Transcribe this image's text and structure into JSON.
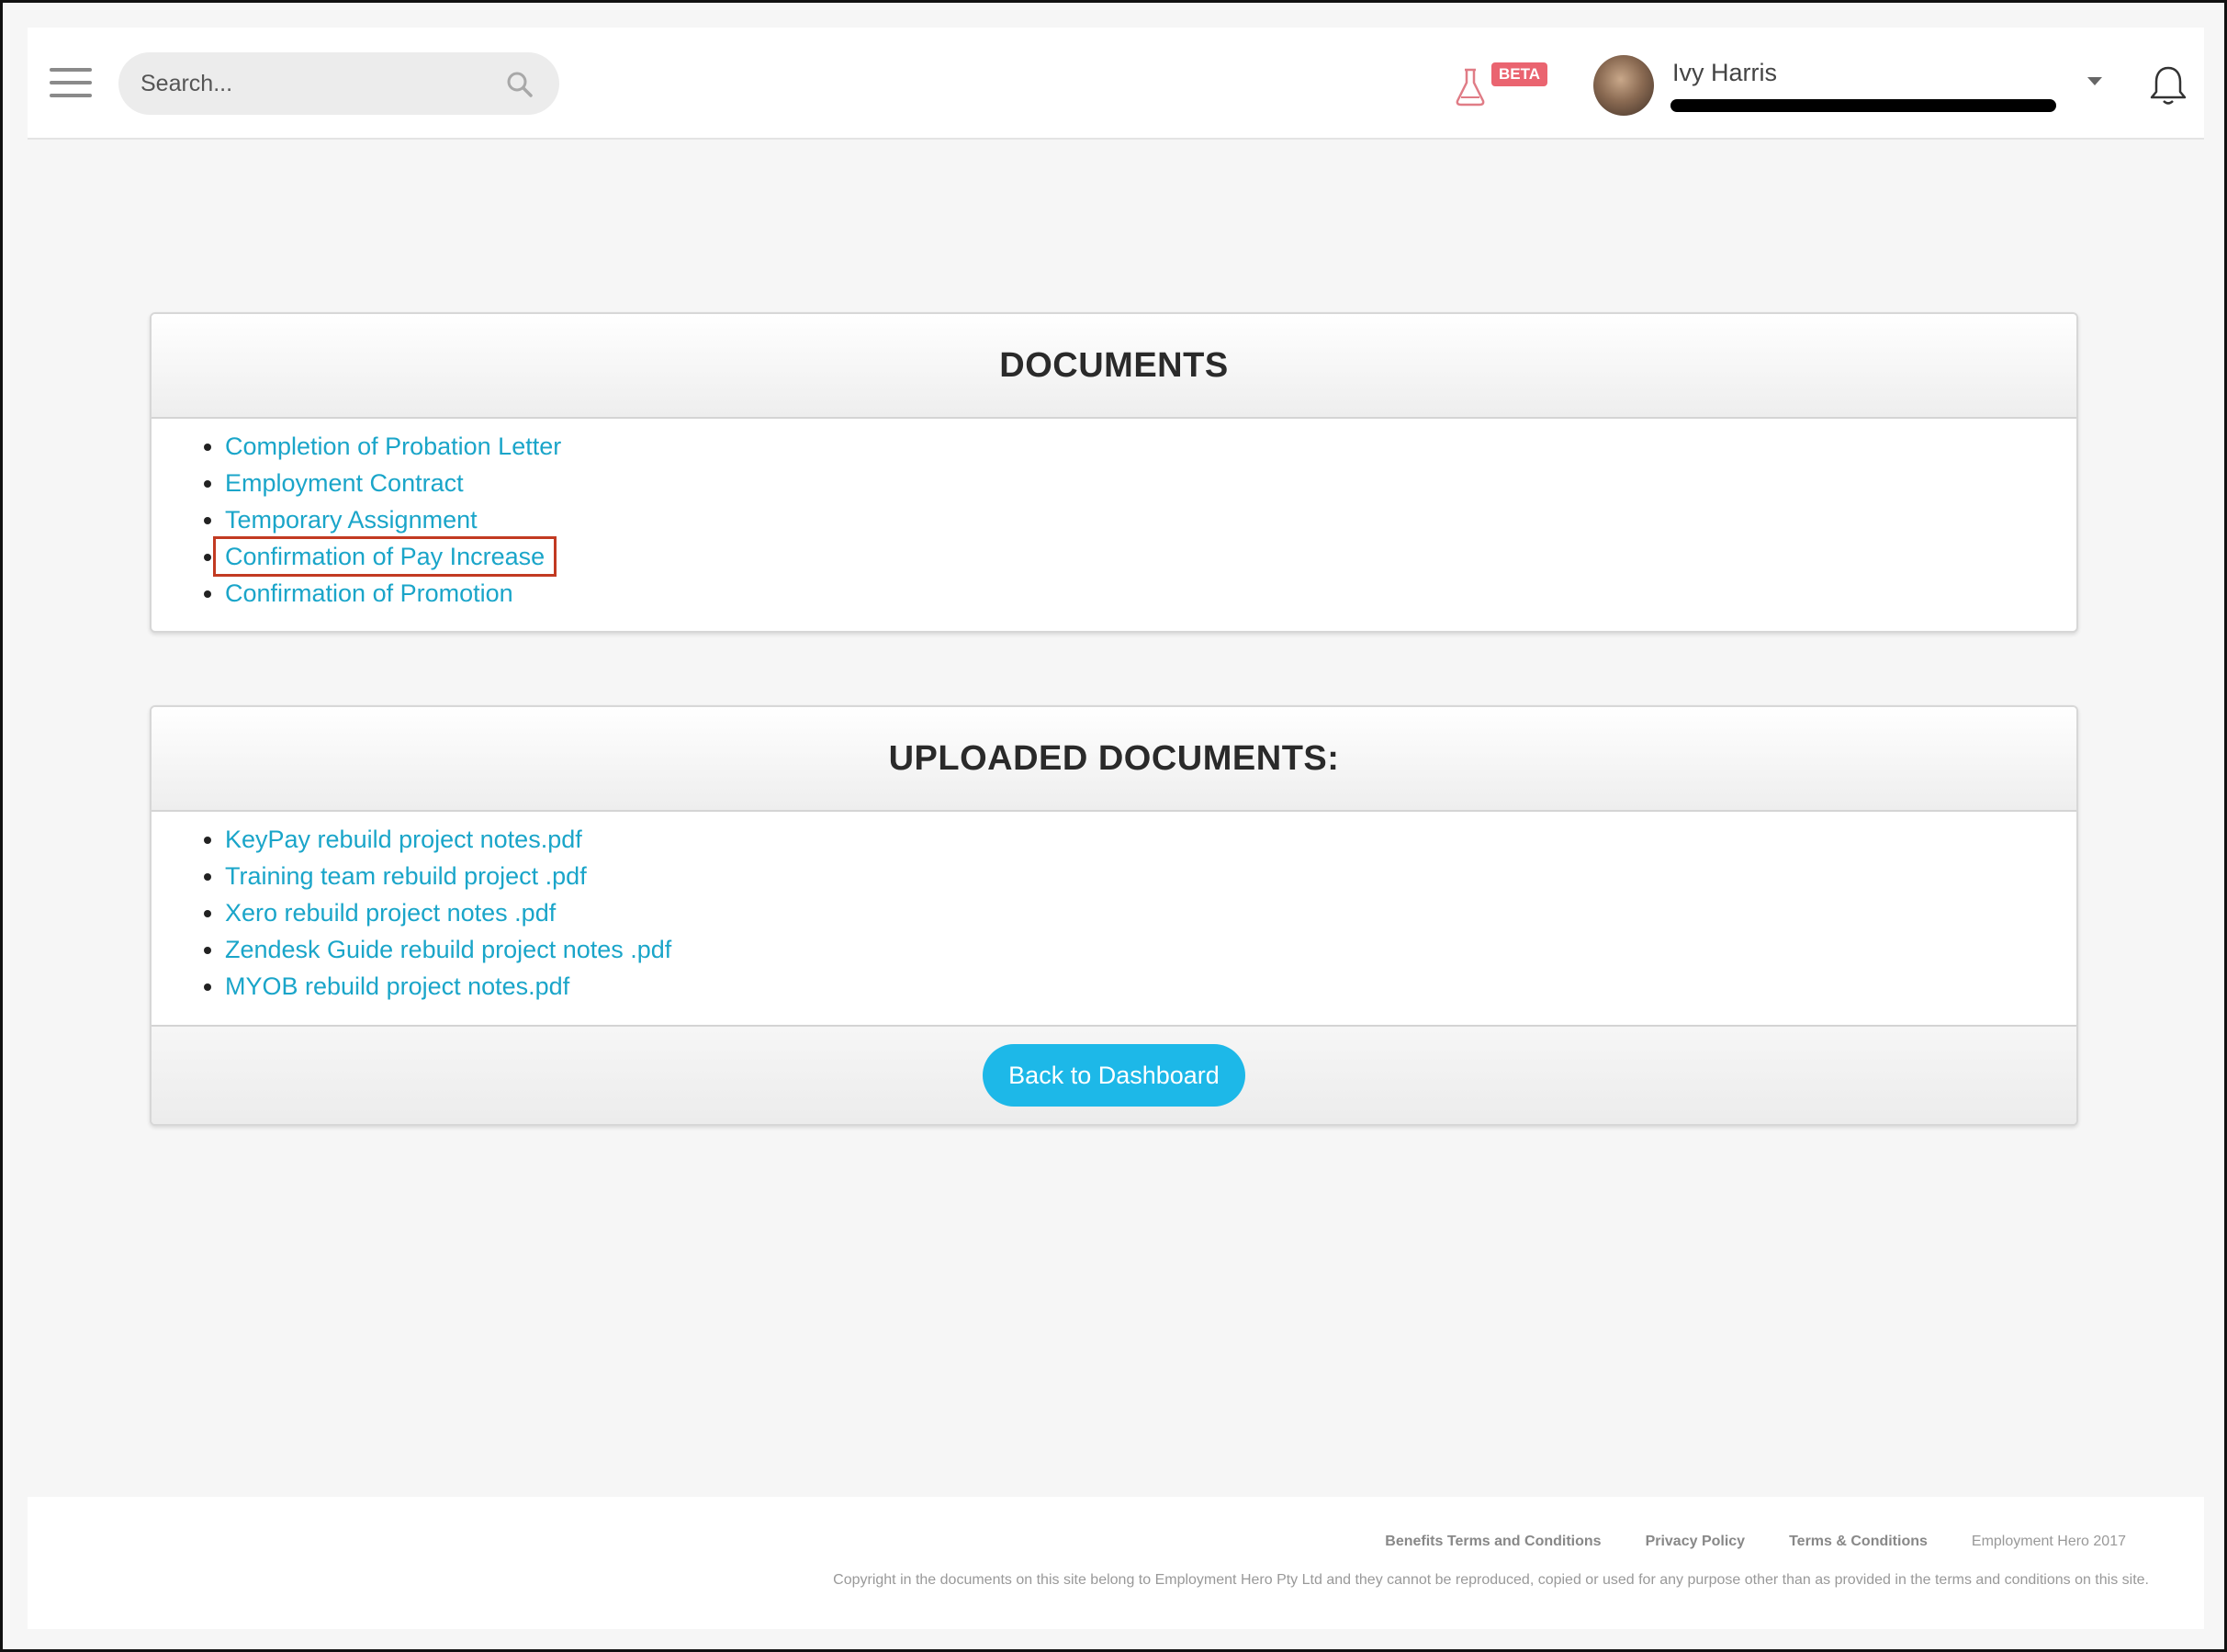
{
  "header": {
    "search_placeholder": "Search...",
    "beta_label": "BETA",
    "user_name": "Ivy Harris"
  },
  "documents": {
    "title": "DOCUMENTS",
    "items": [
      "Completion of Probation Letter",
      "Employment Contract",
      "Temporary Assignment",
      "Confirmation of Pay Increase",
      "Confirmation of Promotion"
    ]
  },
  "uploaded": {
    "title": "UPLOADED DOCUMENTS:",
    "items": [
      "KeyPay rebuild project notes.pdf",
      "Training team rebuild project .pdf",
      "Xero rebuild project notes .pdf",
      "Zendesk Guide rebuild project notes .pdf",
      "MYOB rebuild project notes.pdf"
    ],
    "back_button": "Back to Dashboard"
  },
  "footer": {
    "links": [
      "Benefits Terms and Conditions",
      "Privacy Policy",
      "Terms & Conditions"
    ],
    "brand": "Employment Hero 2017",
    "copyright": "Copyright in the documents on this site belong to Employment Hero Pty Ltd and they cannot be reproduced, copied or used for any purpose other than as provided in the terms and conditions on this site."
  },
  "colors": {
    "link": "#1aa5c9",
    "button": "#1db8e8",
    "beta_badge": "#ea6470",
    "highlight": "#c23a22"
  }
}
